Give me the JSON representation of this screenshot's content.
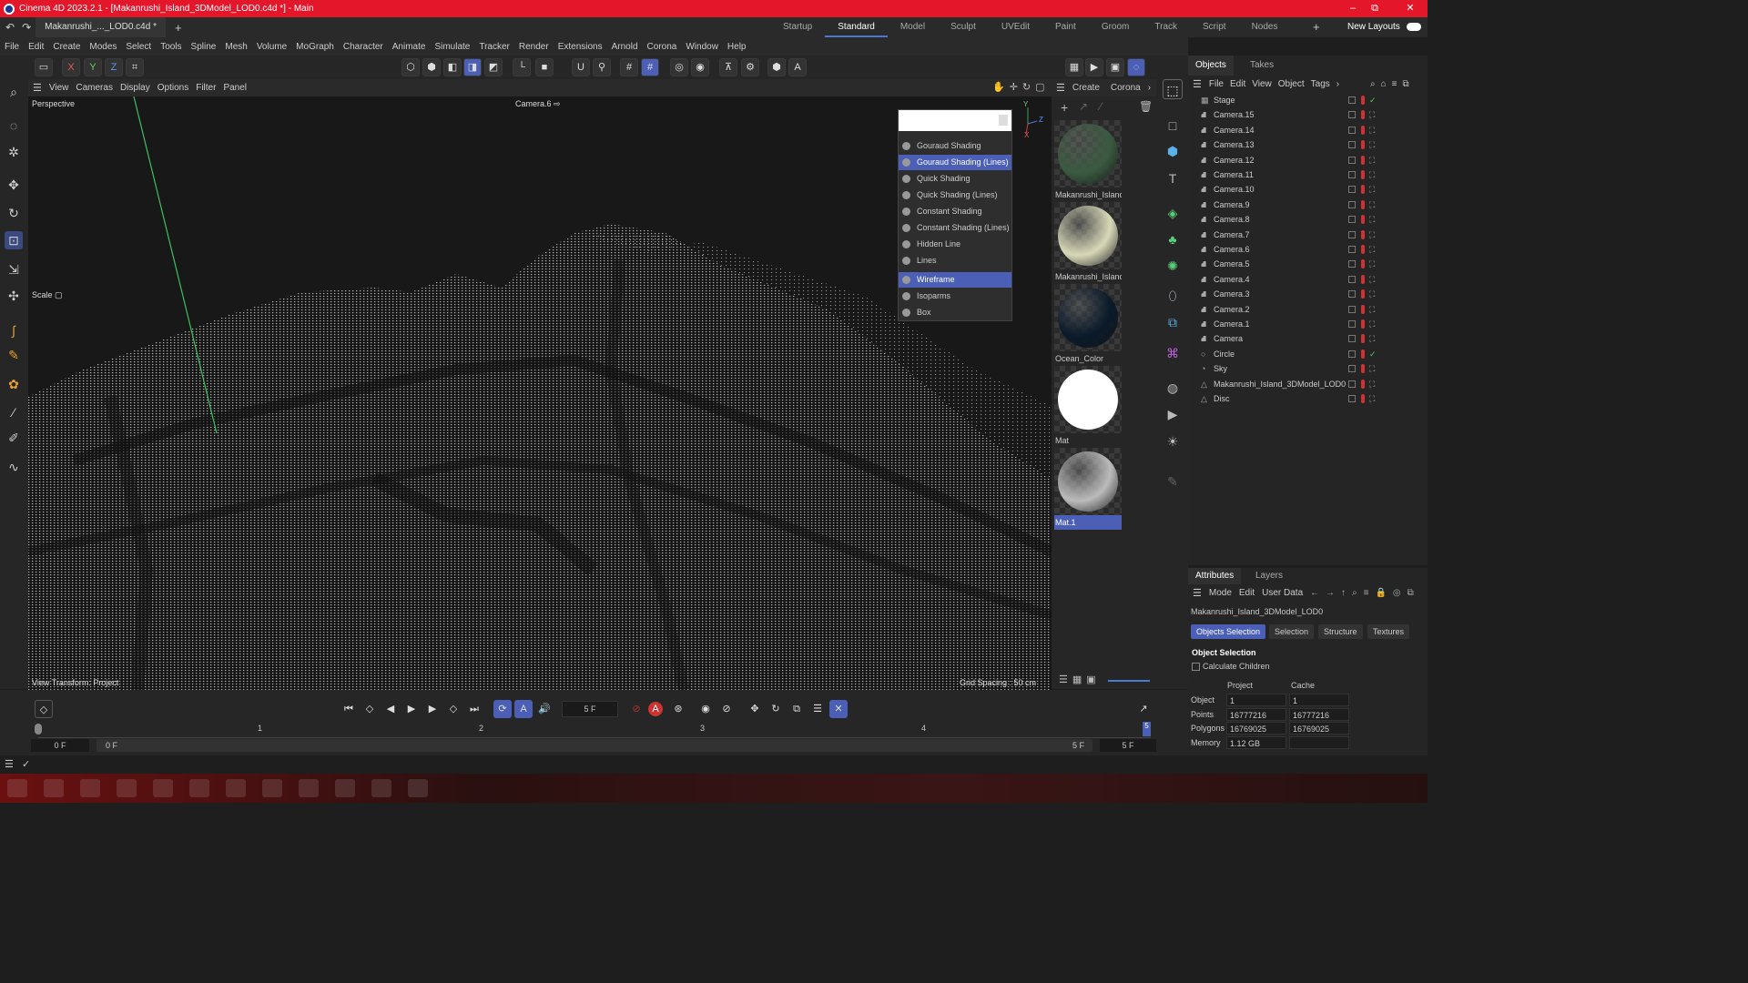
{
  "window": {
    "title": "Cinema 4D 2023.2.1 - [Makanrushi_Island_3DModel_LOD0.c4d *] - Main",
    "min": "–",
    "max": "⧉",
    "close": "✕"
  },
  "tabs": {
    "doc_tab": "Makanrushi_..._LOD0.c4d *",
    "add": "+",
    "layouts": [
      "Startup",
      "Standard",
      "Model",
      "Sculpt",
      "UVEdit",
      "Paint",
      "Groom",
      "Track",
      "Script",
      "Nodes"
    ],
    "active_layout": "Standard",
    "new_layouts": "New Layouts",
    "add_layout": "+"
  },
  "menu": [
    "File",
    "Edit",
    "Create",
    "Modes",
    "Select",
    "Tools",
    "Spline",
    "Mesh",
    "Volume",
    "MoGraph",
    "Character",
    "Animate",
    "Simulate",
    "Tracker",
    "Render",
    "Extensions",
    "Arnold",
    "Corona",
    "Window",
    "Help"
  ],
  "toolbar": {
    "x": "X",
    "y": "Y",
    "z": "Z"
  },
  "viewport": {
    "menu": [
      "View",
      "Cameras",
      "Display",
      "Options",
      "Filter",
      "Panel"
    ],
    "name": "Perspective",
    "camera": "Camera.6",
    "tool": "Scale",
    "transform": "View Transform: Project",
    "grid_spacing": "Grid Spacing : 50 cm",
    "axis_y": "Y",
    "axis_z": "Z",
    "axis_x": "X"
  },
  "display_menu": [
    {
      "label": "Gouraud Shading",
      "selected": false
    },
    {
      "label": "Gouraud Shading (Lines)",
      "selected": true
    },
    {
      "label": "Quick Shading",
      "selected": false
    },
    {
      "label": "Quick Shading (Lines)",
      "selected": false
    },
    {
      "label": "Constant Shading",
      "selected": false
    },
    {
      "label": "Constant Shading (Lines)",
      "selected": false
    },
    {
      "label": "Hidden Line",
      "selected": false
    },
    {
      "label": "Lines",
      "selected": false
    },
    {
      "label": "Wireframe",
      "selected": true
    },
    {
      "label": "Isoparms",
      "selected": false
    },
    {
      "label": "Box",
      "selected": false
    }
  ],
  "materials": {
    "menu": [
      "Create",
      "Corona"
    ],
    "items": [
      {
        "label": "Makanrushi_Islanc",
        "color": "#3a5a40"
      },
      {
        "label": "Makanrushi_Islanc",
        "color": "#d8d8b8"
      },
      {
        "label": "Ocean_Color",
        "color": "#0a1a2a"
      },
      {
        "label": "Mat",
        "color": "#ffffff"
      },
      {
        "label": "Mat.1",
        "color": "#bbbbbb"
      }
    ]
  },
  "objects": {
    "tabs": [
      "Objects",
      "Takes"
    ],
    "menu": [
      "File",
      "Edit",
      "View",
      "Object",
      "Tags"
    ],
    "items": [
      "Stage",
      "Camera.15",
      "Camera.14",
      "Camera.13",
      "Camera.12",
      "Camera.11",
      "Camera.10",
      "Camera.9",
      "Camera.8",
      "Camera.7",
      "Camera.6",
      "Camera.5",
      "Camera.4",
      "Camera.3",
      "Camera.2",
      "Camera.1",
      "Camera",
      "Circle",
      "Sky",
      "Makanrushi_Island_3DModel_LOD0",
      "Disc"
    ]
  },
  "attributes": {
    "tabs": [
      "Attributes",
      "Layers"
    ],
    "menu": [
      "Mode",
      "Edit",
      "User Data"
    ],
    "object_name": "Makanrushi_Island_3DModel_LOD0",
    "subtabs": [
      "Objects Selection",
      "Selection",
      "Structure",
      "Textures"
    ],
    "section": "Object Selection",
    "calc_children": "Calculate Children",
    "col_project": "Project",
    "col_cache": "Cache",
    "rows": [
      {
        "label": "Object",
        "project": "1",
        "cache": "1"
      },
      {
        "label": "Points",
        "project": "16777216",
        "cache": "16777216"
      },
      {
        "label": "Polygons",
        "project": "16769025",
        "cache": "16769025"
      },
      {
        "label": "Memory",
        "project": "1.12 GB",
        "cache": ""
      }
    ]
  },
  "timeline": {
    "frame": "5 F",
    "ticks": [
      "1",
      "2",
      "3",
      "4",
      "5"
    ],
    "start": "0 F",
    "start2": "0 F",
    "end": "5 F",
    "end2": "5 F",
    "accent": "#4a5fb5"
  }
}
